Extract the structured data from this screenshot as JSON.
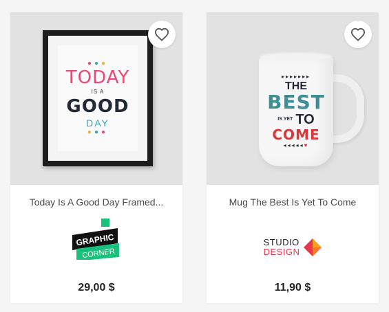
{
  "products": [
    {
      "name": "Today Is A Good Day Framed...",
      "price": "29,00 $",
      "image_text": {
        "top": "TODAY",
        "middle": "IS A",
        "main": "GOOD",
        "bottom": "DAY"
      },
      "brand": {
        "name": "Graphic Corner",
        "line1": "GRAPHIC",
        "line2": "CORNER",
        "colors": {
          "dark": "#111111",
          "green": "#18c27a"
        }
      },
      "wishlist_icon": "heart-outline-icon"
    },
    {
      "name": "Mug The Best Is Yet To Come",
      "price": "11,90 $",
      "image_text": {
        "line1": "THE",
        "line2": "BEST",
        "line3": "IS YET",
        "line4": "TO",
        "line5": "COME"
      },
      "brand": {
        "name": "Studio Design",
        "line1": "STUDIO",
        "line2": "DESIGN",
        "colors": {
          "dark": "#232323",
          "accent": "#e8364f",
          "accent2": "#f6a31a"
        }
      },
      "wishlist_icon": "heart-outline-icon"
    }
  ],
  "colors": {
    "background": "#f5f5f5",
    "card": "#ffffff",
    "thumb": "#e2e2e2",
    "text": "#4a4a4a",
    "price": "#232323"
  }
}
